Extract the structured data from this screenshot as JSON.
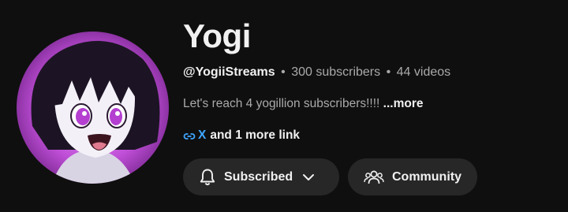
{
  "channel": {
    "name": "Yogi",
    "handle": "@YogiiStreams",
    "separator": "•",
    "subscribers": "300 subscribers",
    "videos": "44 videos",
    "description": "Let's reach 4 yogillion subscribers!!!!",
    "more_label": "...more"
  },
  "links": {
    "icon": "link-icon",
    "first_link": "X",
    "more_links": "and 1 more link"
  },
  "actions": {
    "subscribed_label": "Subscribed",
    "subscribed_icon": "bell-icon",
    "subscribed_chevron": "chevron-down-icon",
    "community_label": "Community",
    "community_icon": "people-icon"
  },
  "colors": {
    "background": "#0f0f0f",
    "button_bg": "#272727",
    "link_blue": "#3ea6ff",
    "avatar_accent": "#c84fe0"
  }
}
